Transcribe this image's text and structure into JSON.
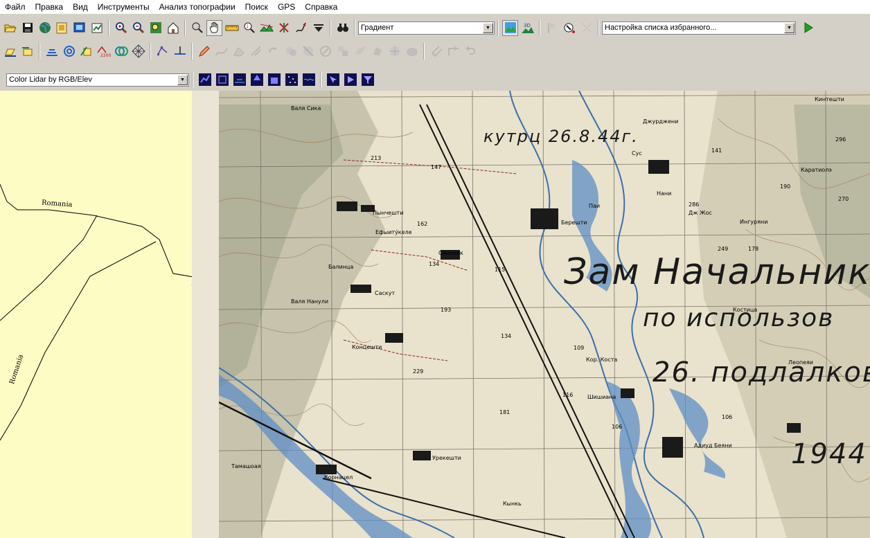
{
  "menu": [
    "Файл",
    "Правка",
    "Вид",
    "Инструменты",
    "Анализ топографии",
    "Поиск",
    "GPS",
    "Справка"
  ],
  "toolbar": {
    "shader_combo": "Градиент",
    "favorites_combo": "Настройка списка избранного...",
    "lidar_combo": "Color Lidar by RGB/Elev"
  },
  "icons": {
    "row1": [
      "open-icon",
      "save-icon",
      "globe-icon",
      "map-catalog-icon",
      "screenshot-icon",
      "export-icon",
      "zoom-in-icon",
      "zoom-out-icon",
      "zoom-box-icon",
      "home-icon",
      "select-icon",
      "hand-pan-icon",
      "ruler-icon",
      "info-icon",
      "terrain-profile-icon",
      "delete-feature-icon",
      "digitize-pen-icon",
      "dropdown-tool-icon",
      "binoculars-icon"
    ],
    "row2": [
      "create-area-icon",
      "edit-area-icon",
      "contour-icon",
      "path-icon",
      "line-edit-icon",
      "elevation-label-icon",
      "circle-overlap-icon",
      "grid-icon",
      "vertex-icon",
      "split-line-icon",
      "pencil-line-icon"
    ]
  },
  "map": {
    "left_labels": [
      "Romania",
      "Romania"
    ],
    "place_names": [
      "Валя Сика",
      "Пынчешти",
      "Саскут",
      "Балинца",
      "Концешти",
      "Урекешти",
      "Корнацел",
      "Тамашоая",
      "Берешти",
      "Сиинеяк",
      "Шишиана",
      "Адиуд Беяни",
      "Леопеяи",
      "Джурджени",
      "Каратиолэ",
      "Паи",
      "Кинтешти",
      "Нани",
      "Ингуряни",
      "Костица",
      "Сус",
      "Дж Жос",
      "Кынкь",
      "Валя Нанули",
      "Ефыиту́келе",
      "Кор. Коста"
    ],
    "spot_heights": [
      "213",
      "147",
      "162",
      "134",
      "193",
      "134",
      "229",
      "116",
      "109",
      "181",
      "106",
      "106",
      "249",
      "178",
      "190",
      "286",
      "141",
      "296",
      "270",
      "115"
    ],
    "handwriting": [
      "кутрц 26.8.44г.",
      "Зам Начальника",
      "по использов",
      "26. подлалков",
      "1944"
    ]
  },
  "colors": {
    "menu_bg": "#ffffff",
    "toolbar_bg": "#d4d0c8",
    "left_pane": "#fcfcc4",
    "map_paper": "#e9e2cc",
    "forest": "#9aa88a",
    "river": "#3a6fb0"
  }
}
